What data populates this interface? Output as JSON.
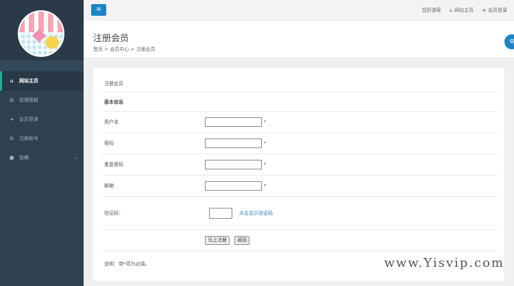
{
  "sidebar": {
    "items": [
      {
        "icon": "home-icon",
        "glyph": "⌂",
        "label": "网站主页",
        "active": true
      },
      {
        "icon": "table-icon",
        "glyph": "▤",
        "label": "管理面板"
      },
      {
        "icon": "login-icon",
        "glyph": "➜",
        "label": "会员登录"
      },
      {
        "icon": "register-icon",
        "glyph": "⊞",
        "label": "注册帐号"
      },
      {
        "icon": "post-icon",
        "glyph": "■",
        "label": "投稿",
        "chevron": "‹"
      }
    ]
  },
  "topbar": {
    "menu_glyph": "≡",
    "greeting": "您好游客",
    "home_glyph": "⌂",
    "home_link": "网站主页",
    "login_glyph": "➜",
    "login_link": "会员登录"
  },
  "header": {
    "title": "注册会员",
    "breadcrumb": "首页 > 会员中心 > 注册会员",
    "settings_glyph": "⚙"
  },
  "form": {
    "section_title": "注册会员",
    "group_title": "基本信息",
    "fields": [
      {
        "label": "用户名",
        "value": "",
        "required": "*"
      },
      {
        "label": "密码",
        "value": "",
        "required": "*"
      },
      {
        "label": "重复密码",
        "value": "",
        "required": "*"
      },
      {
        "label": "邮箱",
        "value": "",
        "required": "*"
      }
    ],
    "captcha_label": "验证码：",
    "captcha_value": "",
    "captcha_link": "点击显示验证码",
    "submit_label": "马上注册",
    "back_label": "返回",
    "note": "说明：带*项为必填。"
  },
  "watermark": "www.Yisvip.com"
}
